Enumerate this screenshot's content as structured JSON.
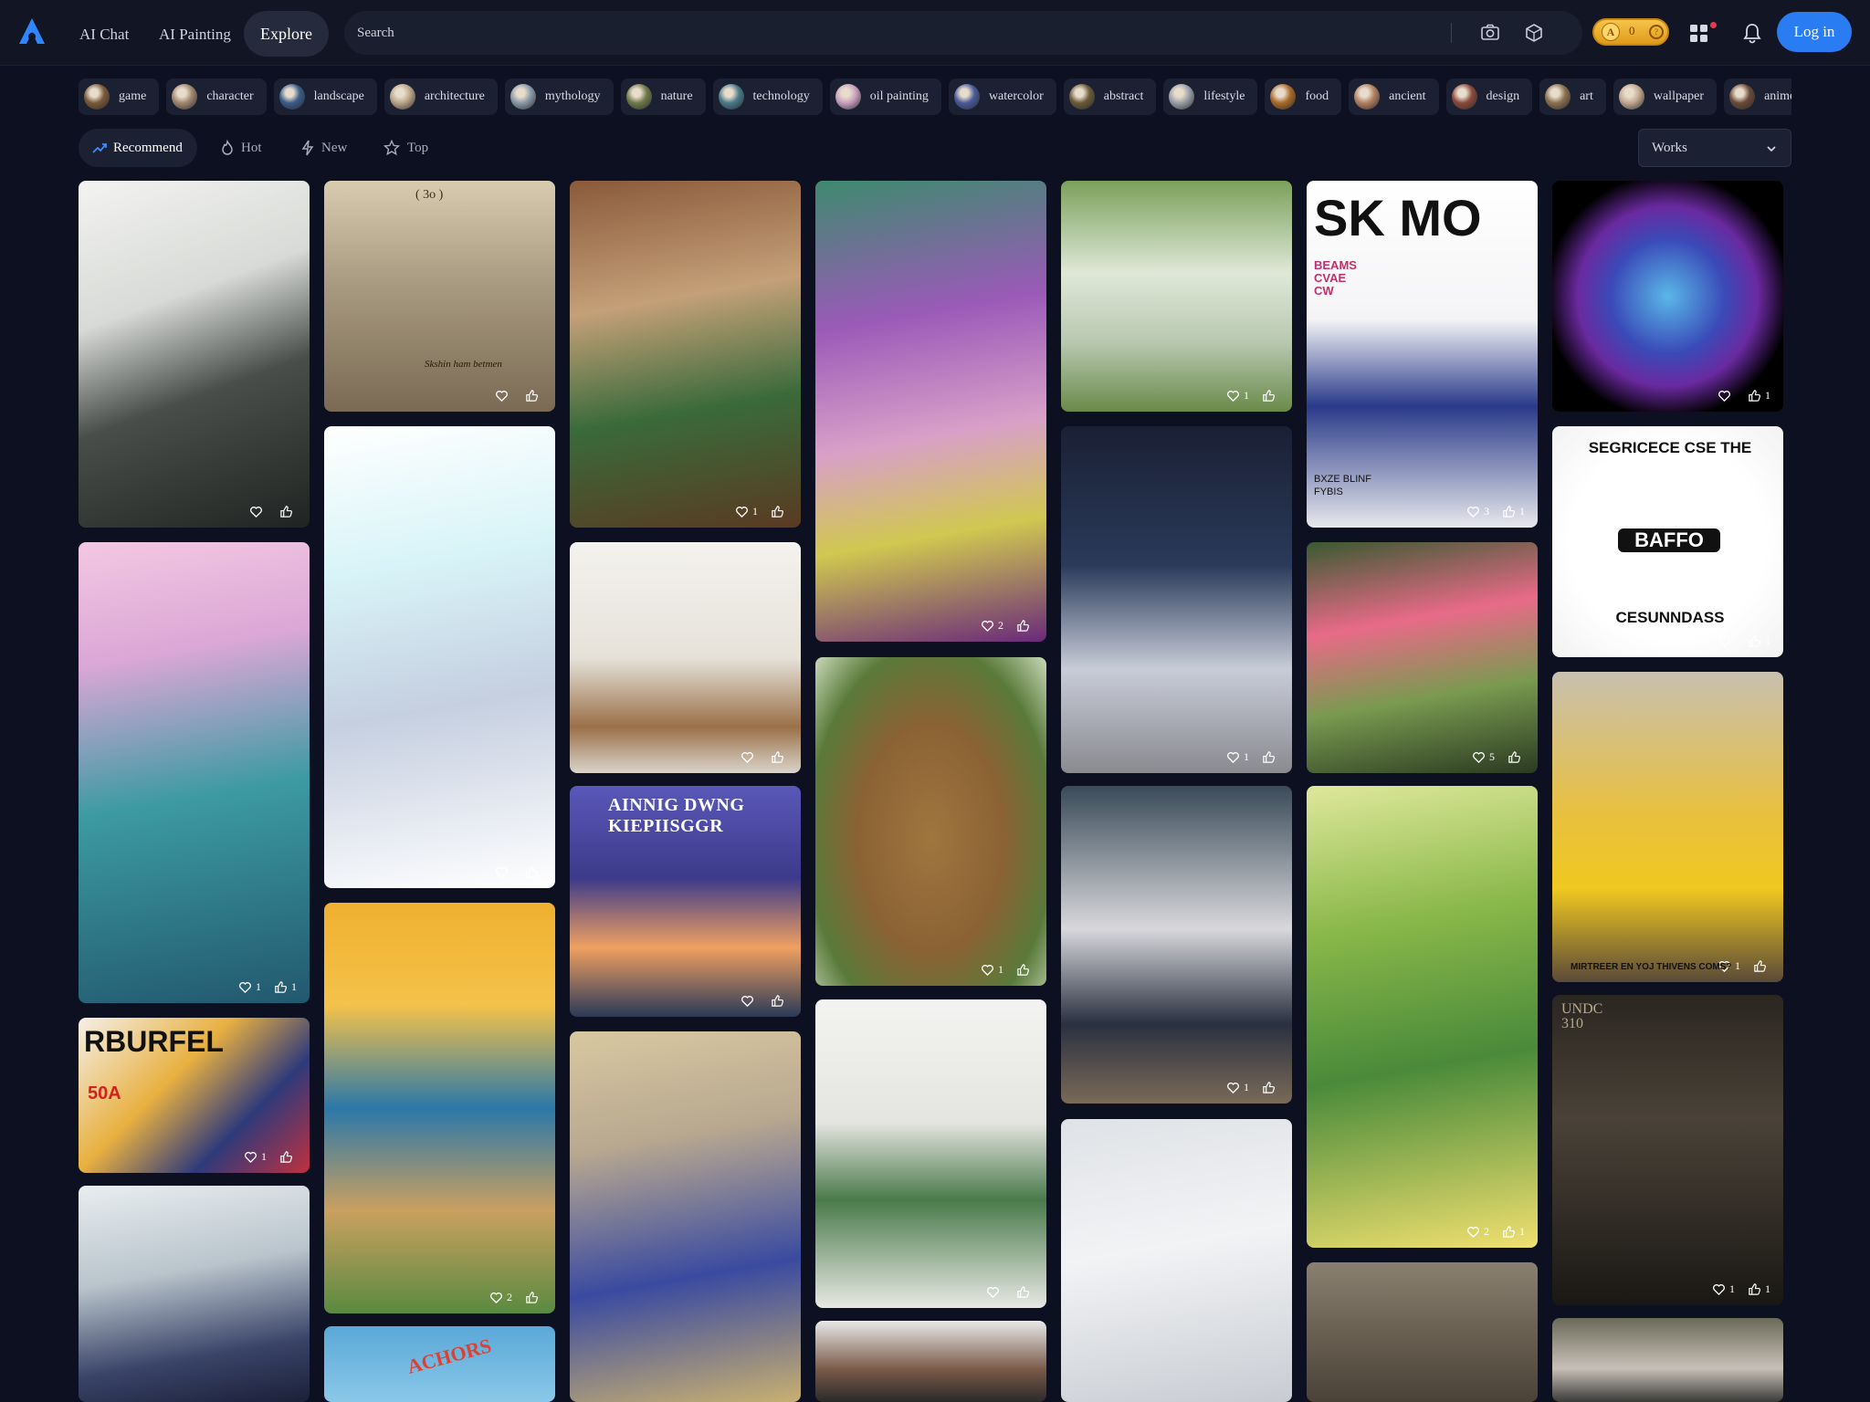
{
  "nav": {
    "ai_chat": "AI Chat",
    "ai_painting": "AI Painting",
    "explore": "Explore",
    "search_placeholder": "Search",
    "coins": "0",
    "login": "Log in"
  },
  "colors": {
    "background": "#0d1021",
    "accent": "#2a7cf2",
    "chip": "#1b2033"
  },
  "categories": [
    {
      "label": "game"
    },
    {
      "label": "character"
    },
    {
      "label": "landscape"
    },
    {
      "label": "architecture"
    },
    {
      "label": "mythology"
    },
    {
      "label": "nature"
    },
    {
      "label": "technology"
    },
    {
      "label": "oil painting"
    },
    {
      "label": "watercolor"
    },
    {
      "label": "abstract"
    },
    {
      "label": "lifestyle"
    },
    {
      "label": "food"
    },
    {
      "label": "ancient"
    },
    {
      "label": "design"
    },
    {
      "label": "art"
    },
    {
      "label": "wallpaper"
    },
    {
      "label": "anime"
    }
  ],
  "filters": {
    "recommend": "Recommend",
    "hot": "Hot",
    "new": "New",
    "top": "Top",
    "works": "Works"
  },
  "cards": [
    {
      "id": 1,
      "subject": "anime man in white shirt",
      "likes": "",
      "thumbs": ""
    },
    {
      "id": 2,
      "subject": "cherry petals on water",
      "likes": "1",
      "thumbs": "1"
    },
    {
      "id": 3,
      "subject": "magazine cover anime girl",
      "likes": "1",
      "thumbs": ""
    },
    {
      "id": 4,
      "subject": "anime girl by window",
      "likes": "",
      "thumbs": ""
    },
    {
      "id": 5,
      "subject": "antique engraving",
      "likes": "",
      "thumbs": ""
    },
    {
      "id": 6,
      "subject": "anime girl cherry blossoms",
      "likes": "",
      "thumbs": ""
    },
    {
      "id": 7,
      "subject": "illustrated tower city",
      "likes": "2",
      "thumbs": ""
    },
    {
      "id": 8,
      "subject": "billboard sky",
      "likes": "",
      "thumbs": ""
    },
    {
      "id": 9,
      "subject": "vintage woman portrait",
      "likes": "1",
      "thumbs": ""
    },
    {
      "id": 10,
      "subject": "shelves with plants",
      "likes": "",
      "thumbs": ""
    },
    {
      "id": 11,
      "subject": "poster three men",
      "likes": "",
      "thumbs": ""
    },
    {
      "id": 12,
      "subject": "anime girl denim shorts",
      "likes": "",
      "thumbs": ""
    },
    {
      "id": 13,
      "subject": "purple flowers",
      "likes": "2",
      "thumbs": ""
    },
    {
      "id": 14,
      "subject": "brown bead sculpture",
      "likes": "1",
      "thumbs": ""
    },
    {
      "id": 15,
      "subject": "living room green sofa",
      "likes": "",
      "thumbs": ""
    },
    {
      "id": 16,
      "subject": "man portrait",
      "likes": "",
      "thumbs": ""
    },
    {
      "id": 17,
      "subject": "glass greenhouse",
      "likes": "1",
      "thumbs": ""
    },
    {
      "id": 18,
      "subject": "anime girl space",
      "likes": "1",
      "thumbs": ""
    },
    {
      "id": 19,
      "subject": "anime girl seated",
      "likes": "1",
      "thumbs": ""
    },
    {
      "id": 20,
      "subject": "white blossoms",
      "likes": "",
      "thumbs": ""
    },
    {
      "id": 21,
      "subject": "magazine cover woman",
      "likes": "3",
      "thumbs": "1"
    },
    {
      "id": 22,
      "subject": "pink flowers field",
      "likes": "5",
      "thumbs": ""
    },
    {
      "id": 23,
      "subject": "green leaves",
      "likes": "2",
      "thumbs": "1"
    },
    {
      "id": 24,
      "subject": "ink leaves",
      "likes": "",
      "thumbs": ""
    },
    {
      "id": 25,
      "subject": "blue lily flower",
      "likes": "",
      "thumbs": "1"
    },
    {
      "id": 26,
      "subject": "round logo mouse cup",
      "likes": "",
      "thumbs": "1"
    },
    {
      "id": 27,
      "subject": "smiling man yellow shirt",
      "likes": "1",
      "thumbs": ""
    },
    {
      "id": 28,
      "subject": "woman black leather",
      "likes": "1",
      "thumbs": "1"
    },
    {
      "id": 29,
      "subject": "anime girl plants",
      "likes": "",
      "thumbs": ""
    }
  ],
  "card_text": {
    "engraving_caption": "( 3o )",
    "engraving_lines": "Skshin ham betmen",
    "poster_title": "AINNIG DWNG KIEPIISGGR",
    "magazine_title": "SK  MO",
    "magazine_sub": "BEAMS CVAE CW",
    "magazine_bottom": "BXZE BLINF FYBIS",
    "comic_title": "RBURFEL",
    "comic_price": "50A",
    "logo_ring": "SEGRICECE CSE THE",
    "logo_center": "BAFFO",
    "logo_bottom": "CESUNNDASS",
    "billboard": "ACHORS",
    "yellow_banner": "MIRTREER EN YOJ THIVENS COMS?",
    "poster_side": "UNDC 310"
  }
}
